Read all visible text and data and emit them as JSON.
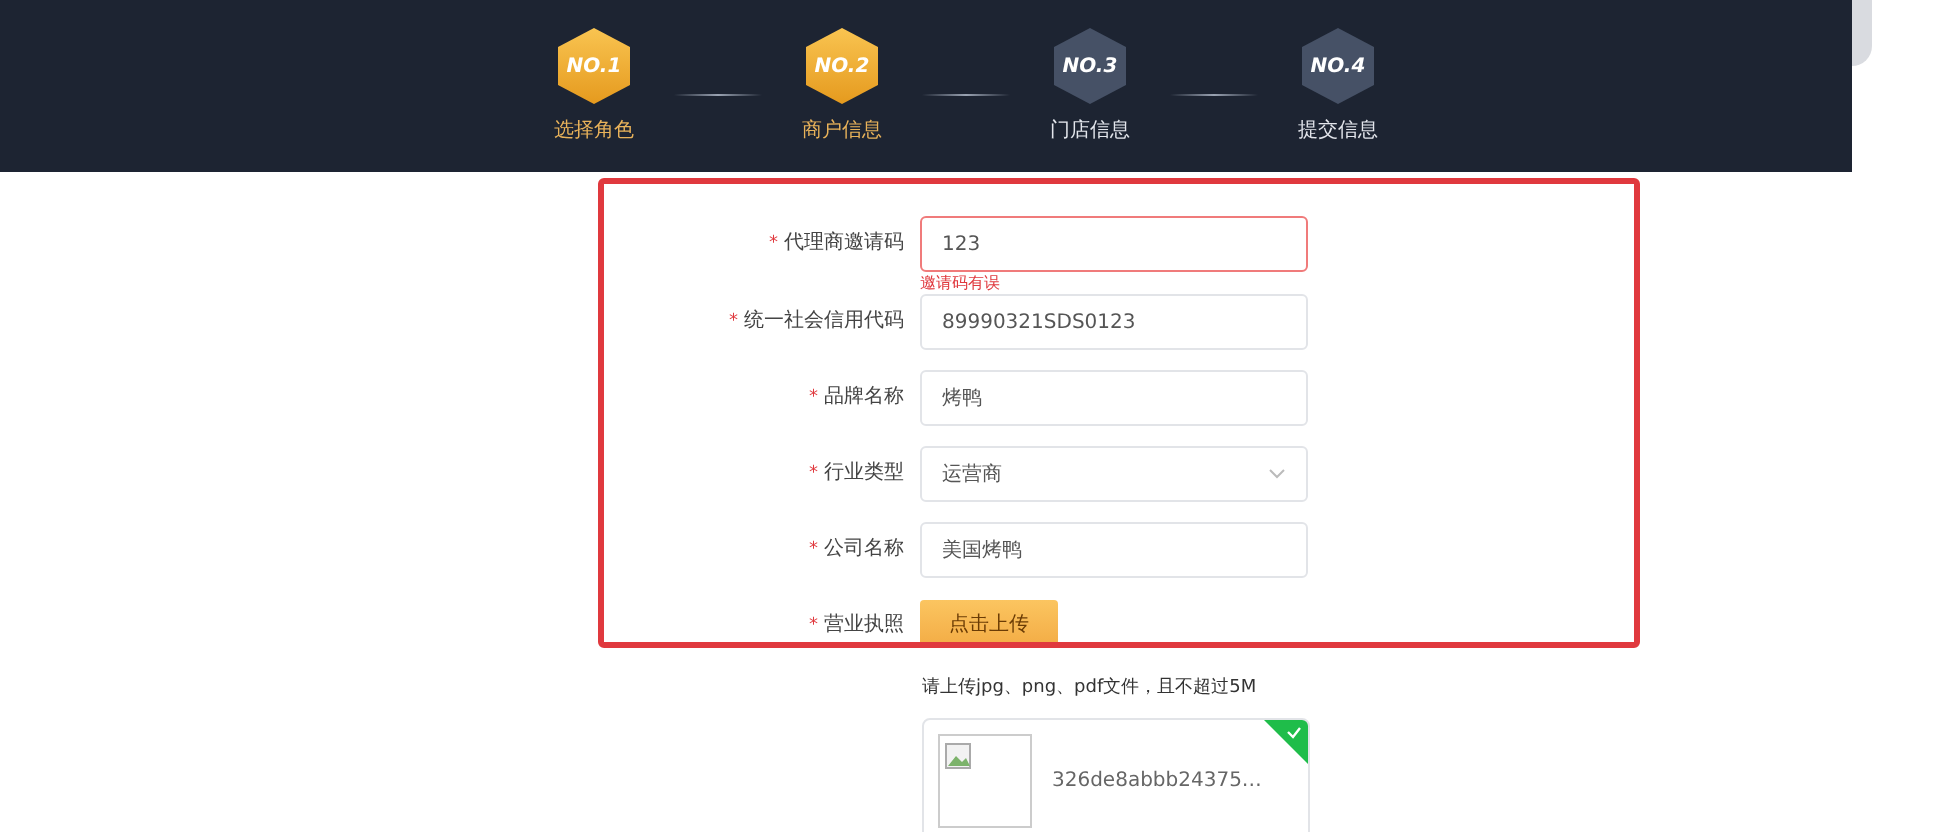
{
  "steps": [
    {
      "badge": "NO.1",
      "label": "选择角色",
      "active": true
    },
    {
      "badge": "NO.2",
      "label": "商户信息",
      "active": true
    },
    {
      "badge": "NO.3",
      "label": "门店信息",
      "active": false
    },
    {
      "badge": "NO.4",
      "label": "提交信息",
      "active": false
    }
  ],
  "form": {
    "fields": [
      {
        "kind": "input",
        "mark": "*",
        "label": "代理商邀请码",
        "value": "123",
        "error": "邀请码有误"
      },
      {
        "kind": "input",
        "mark": "*",
        "label": "统一社会信用代码",
        "value": "89990321SDS0123"
      },
      {
        "kind": "input",
        "mark": "*",
        "label": "品牌名称",
        "value": "烤鸭"
      },
      {
        "kind": "select",
        "mark": "*",
        "label": "行业类型",
        "value": "运营商"
      },
      {
        "kind": "input",
        "mark": "*",
        "label": "公司名称",
        "value": "美国烤鸭"
      },
      {
        "kind": "upload",
        "mark": "*",
        "label": "营业执照",
        "button": "点击上传"
      }
    ]
  },
  "upload": {
    "hint": "请上传jpg、png、pdf文件，且不超过5M",
    "file_name": "326de8abbb24375…",
    "done": true
  }
}
